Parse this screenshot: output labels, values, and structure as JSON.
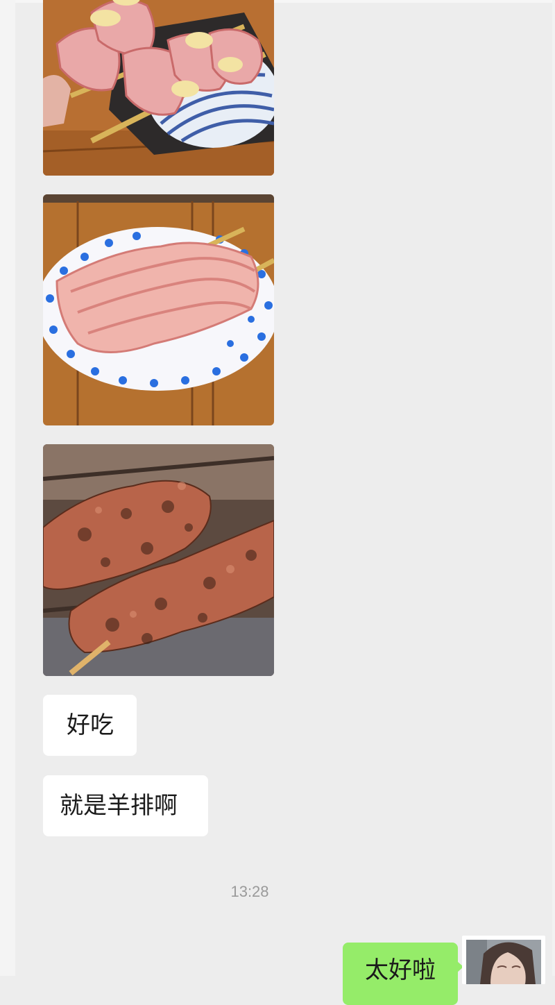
{
  "chat": {
    "messages": [
      {
        "type": "image",
        "sender": "other",
        "icon": "raw-pork-skewers-photo"
      },
      {
        "type": "image",
        "sender": "other",
        "icon": "pork-belly-skewers-plate-photo"
      },
      {
        "type": "image",
        "sender": "other",
        "icon": "grilled-skewers-photo"
      },
      {
        "type": "text",
        "sender": "other",
        "text": "好吃"
      },
      {
        "type": "text",
        "sender": "other",
        "text": "就是羊排啊"
      }
    ],
    "timestamp": "13:28",
    "self_message": {
      "type": "text",
      "sender": "self",
      "text": "太好啦"
    }
  },
  "colors": {
    "background": "#ededed",
    "self_bubble": "#95ec69",
    "other_bubble": "#ffffff",
    "timestamp": "#9a9a9a"
  }
}
